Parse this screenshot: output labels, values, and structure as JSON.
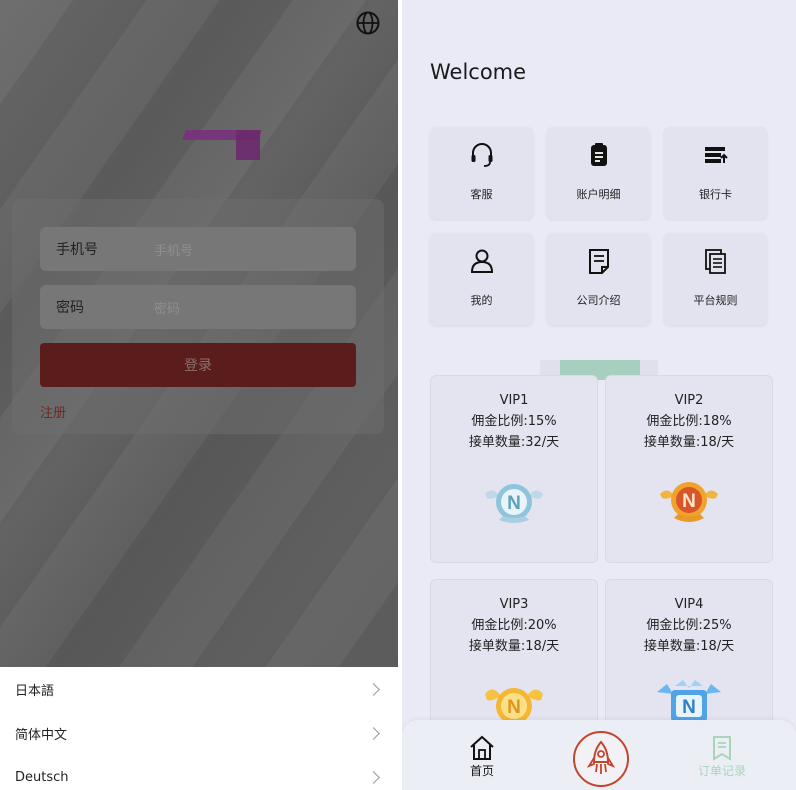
{
  "login": {
    "phone_label": "手机号",
    "phone_placeholder": "手机号",
    "password_label": "密码",
    "password_placeholder": "密码",
    "login_button": "登录",
    "register_link": "注册"
  },
  "languages": [
    "日本語",
    "简体中文",
    "Deutsch"
  ],
  "home": {
    "welcome": "Welcome",
    "tiles": [
      {
        "label": "客服",
        "icon": "headset-icon"
      },
      {
        "label": "账户明细",
        "icon": "account-details-icon"
      },
      {
        "label": "银行卡",
        "icon": "bank-card-icon"
      },
      {
        "label": "我的",
        "icon": "user-icon"
      },
      {
        "label": "公司介绍",
        "icon": "document-icon"
      },
      {
        "label": "平台规则",
        "icon": "rules-icon"
      }
    ],
    "vip_levels": [
      {
        "name": "VIP1",
        "commission": "佣金比例:15%",
        "orders": "接单数量:32/天",
        "badge": "silver-badge-icon"
      },
      {
        "name": "VIP2",
        "commission": "佣金比例:18%",
        "orders": "接单数量:18/天",
        "badge": "bronze-badge-icon"
      },
      {
        "name": "VIP3",
        "commission": "佣金比例:20%",
        "orders": "接单数量:18/天",
        "badge": "gold-badge-icon"
      },
      {
        "name": "VIP4",
        "commission": "佣金比例:25%",
        "orders": "接单数量:18/天",
        "badge": "diamond-badge-icon"
      }
    ],
    "tabbar": {
      "home_label": "首页",
      "orders_label": "订单记录"
    }
  },
  "colors": {
    "login_button": "#5a1d1b",
    "accent_red": "#c4442e",
    "active_tab_green": "#a8d5ba",
    "right_bg": "#e9eaf5"
  }
}
